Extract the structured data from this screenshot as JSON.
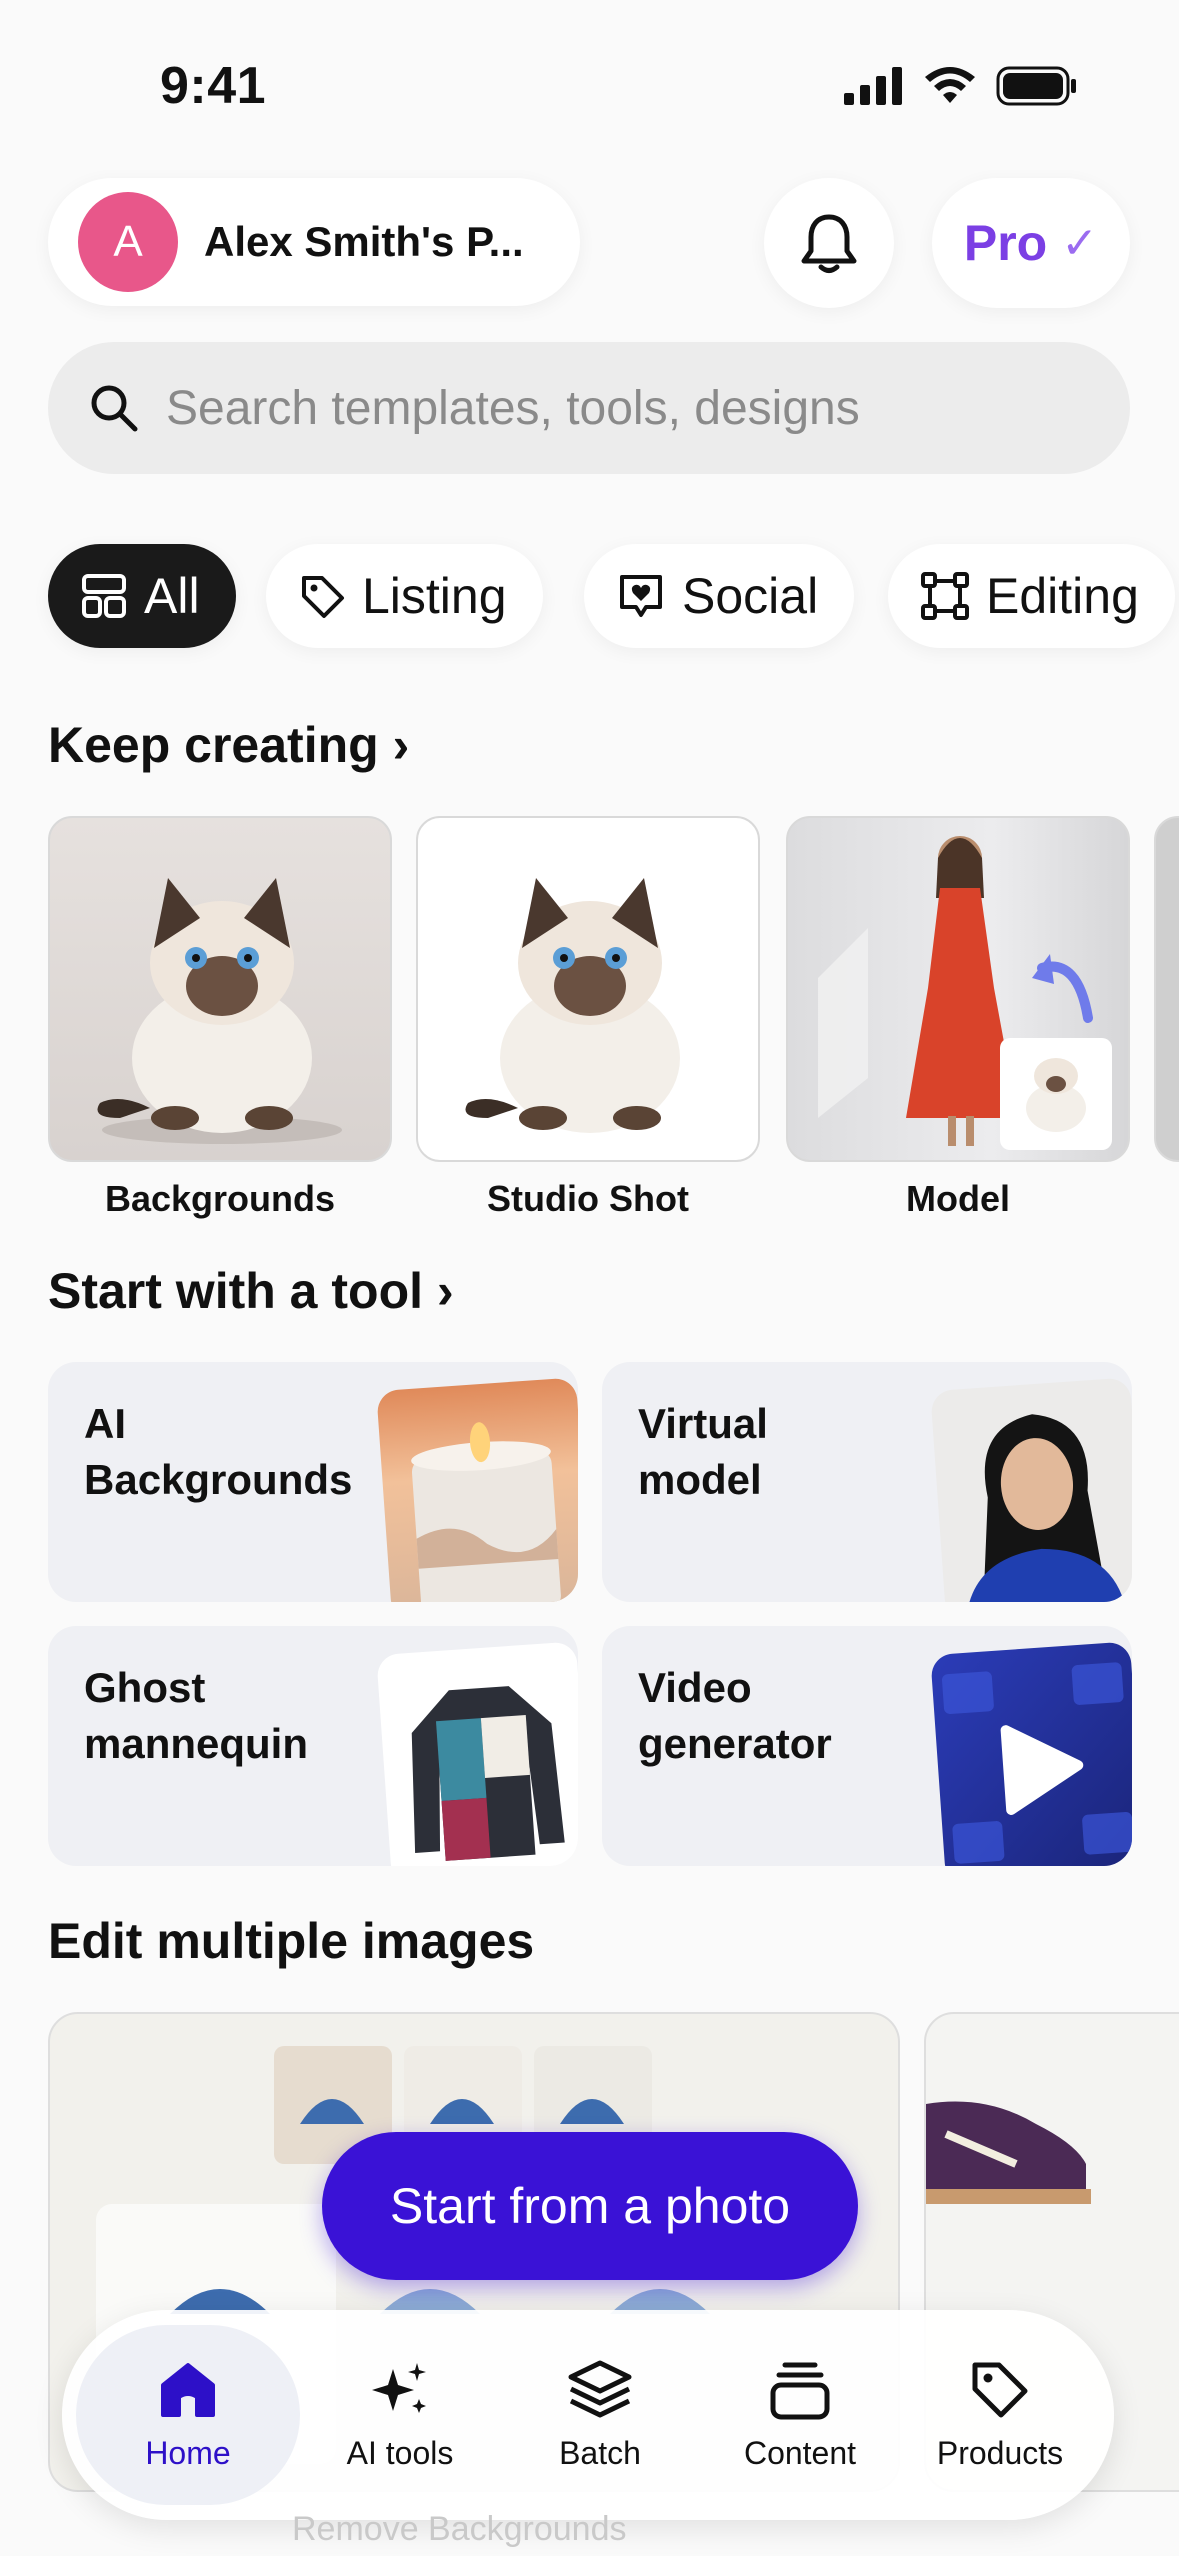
{
  "status": {
    "time": "9:41"
  },
  "header": {
    "avatar_letter": "A",
    "account_name": "Alex Smith's P...",
    "pro_label": "Pro",
    "pro_check": "✓"
  },
  "search": {
    "placeholder": "Search templates, tools, designs"
  },
  "chips": [
    {
      "label": "All",
      "icon": "layout-icon",
      "active": true
    },
    {
      "label": "Listing",
      "icon": "tag-icon"
    },
    {
      "label": "Social",
      "icon": "heart-chat-icon"
    },
    {
      "label": "Editing",
      "icon": "crop-frame-icon"
    }
  ],
  "keep_creating": {
    "title": "Keep creating",
    "cards": [
      {
        "label": "Backgrounds"
      },
      {
        "label": "Studio Shot"
      },
      {
        "label": "Model"
      }
    ]
  },
  "tools": {
    "title": "Start with a tool",
    "items": [
      {
        "label_line1": "AI",
        "label_line2": "Backgrounds"
      },
      {
        "label_line1": "Virtual",
        "label_line2": "model"
      },
      {
        "label_line1": "Ghost",
        "label_line2": "mannequin"
      },
      {
        "label_line1": "Video",
        "label_line2": "generator"
      }
    ]
  },
  "edit_multiple": {
    "title": "Edit multiple images",
    "cta": "Start from a photo",
    "caption": "Remove Backgrounds"
  },
  "tabbar": {
    "items": [
      {
        "label": "Home",
        "icon": "home-icon",
        "active": true
      },
      {
        "label": "AI tools",
        "icon": "sparkles-icon"
      },
      {
        "label": "Batch",
        "icon": "layers-icon"
      },
      {
        "label": "Content",
        "icon": "stack-icon"
      },
      {
        "label": "Products",
        "icon": "tag-icon"
      }
    ]
  },
  "colors": {
    "accent": "#3a12d6",
    "pro": "#7b3fe4",
    "avatar": "#e8578a"
  }
}
